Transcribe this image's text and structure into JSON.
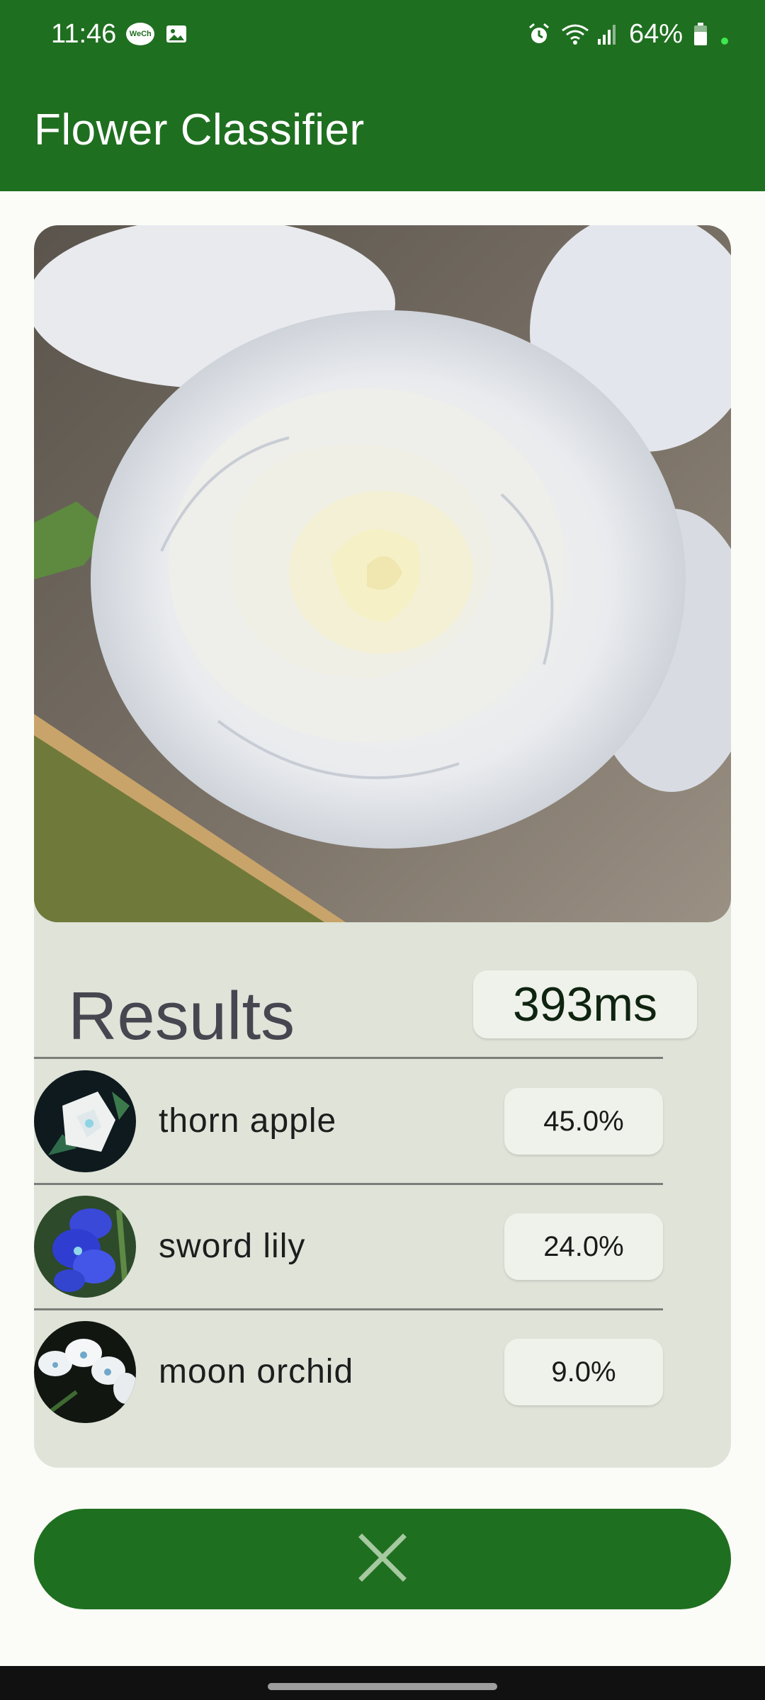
{
  "status_bar": {
    "time": "11:46",
    "battery": "64%",
    "icons": [
      "wechat-icon",
      "gallery-icon",
      "alarm-icon",
      "wifi-icon",
      "signal-icon",
      "battery-icon"
    ]
  },
  "app_bar": {
    "title": "Flower Classifier"
  },
  "results": {
    "title": "Results",
    "inference_time": "393ms",
    "items": [
      {
        "label": "thorn apple",
        "confidence": "45.0%"
      },
      {
        "label": "sword lily",
        "confidence": "24.0%"
      },
      {
        "label": "moon orchid",
        "confidence": "9.0%"
      }
    ]
  },
  "actions": {
    "close_icon": "close-icon"
  },
  "colors": {
    "primary": "#1f6f20",
    "card_background": "#dfe3d8",
    "chip_background": "#eef2ea",
    "page_background": "#fbfcf7"
  }
}
